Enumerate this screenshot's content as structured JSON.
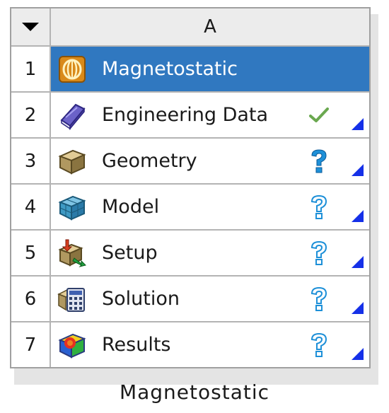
{
  "system": {
    "column_header": "A",
    "caption": "Magnetostatic",
    "rows": [
      {
        "num": "1",
        "label": "Magnetostatic",
        "icon": "magnetostatic-icon",
        "status": ""
      },
      {
        "num": "2",
        "label": "Engineering Data",
        "icon": "engineering-data-icon",
        "status": "up-to-date"
      },
      {
        "num": "3",
        "label": "Geometry",
        "icon": "geometry-icon",
        "status": "attention-required"
      },
      {
        "num": "4",
        "label": "Model",
        "icon": "model-icon",
        "status": "unfulfilled"
      },
      {
        "num": "5",
        "label": "Setup",
        "icon": "setup-icon",
        "status": "unfulfilled"
      },
      {
        "num": "6",
        "label": "Solution",
        "icon": "solution-icon",
        "status": "unfulfilled"
      },
      {
        "num": "7",
        "label": "Results",
        "icon": "results-icon",
        "status": "unfulfilled"
      }
    ]
  },
  "colors": {
    "selected_row": "#3078c0",
    "corner_arrow": "#1530e8",
    "check": "#6aa84f",
    "question": "#1e90d8"
  }
}
